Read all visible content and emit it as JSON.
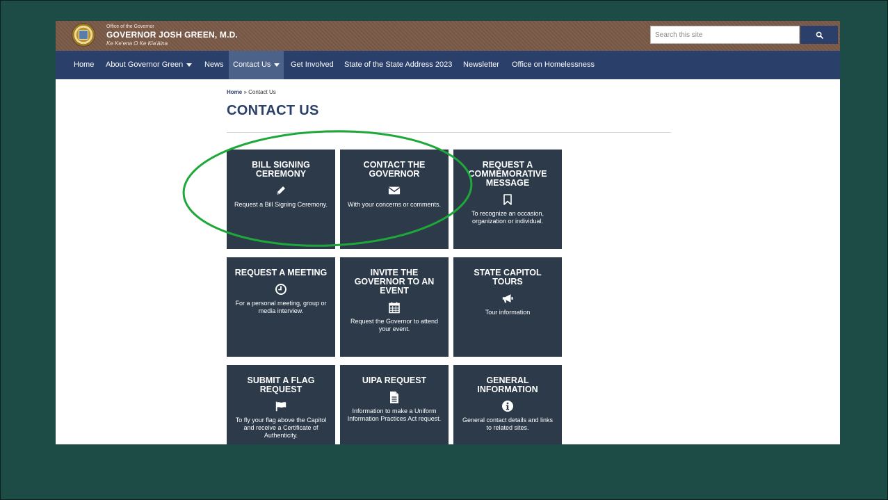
{
  "header": {
    "office_label": "Office of the Governor",
    "title": "GOVERNOR JOSH GREEN, M.D.",
    "tagline": "Ke Keʻena O Ke Kiaʻāina",
    "seal_icon": "state-seal-icon"
  },
  "search": {
    "placeholder": "Search this site",
    "button_icon": "search-icon"
  },
  "nav": {
    "items": [
      {
        "label": "Home"
      },
      {
        "label": "About Governor Green",
        "has_dropdown": true
      },
      {
        "label": "News"
      },
      {
        "label": "Contact Us",
        "has_dropdown": true,
        "active": true
      },
      {
        "label": "Get Involved"
      },
      {
        "label": "State of the State Address 2023"
      },
      {
        "label": "Newsletter"
      },
      {
        "label": "Office on Homelessness"
      }
    ]
  },
  "breadcrumb": {
    "home": "Home",
    "separator": "»",
    "current": "Contact Us"
  },
  "page": {
    "title": "CONTACT US"
  },
  "cards": [
    {
      "title": "BILL SIGNING CEREMONY",
      "icon": "pencil-icon",
      "description": "Request a Bill Signing Ceremony."
    },
    {
      "title": "CONTACT THE GOVERNOR",
      "icon": "envelope-icon",
      "description": "With your concerns or comments."
    },
    {
      "title": "REQUEST A COMMEMORATIVE MESSAGE",
      "icon": "bookmark-icon",
      "description": "To recognize an occasion, organization or individual."
    },
    {
      "title": "REQUEST A MEETING",
      "icon": "clock-icon",
      "description": "For a personal meeting, group or media interview."
    },
    {
      "title": "INVITE THE GOVERNOR TO AN EVENT",
      "icon": "calendar-icon",
      "description": "Request the Governor to attend your event."
    },
    {
      "title": "STATE CAPITOL TOURS",
      "icon": "megaphone-icon",
      "description": "Tour information"
    },
    {
      "title": "SUBMIT A FLAG REQUEST",
      "icon": "flag-icon",
      "description": "To fly your flag above the Capitol and receive a Certificate of Authenticity."
    },
    {
      "title": "UIPA REQUEST",
      "icon": "document-icon",
      "description": "Information to make a Uniform Information Practices Act request."
    },
    {
      "title": "GENERAL INFORMATION",
      "icon": "info-icon",
      "description": "General contact details and links to related sites."
    }
  ],
  "colors": {
    "slide_background": "#1d4c47",
    "header_brown": "#7a5a47",
    "nav_blue": "#2a3f6a",
    "nav_active": "#4c6289",
    "card_background": "#2c3a4a",
    "annotation_green": "#1fa83a"
  }
}
